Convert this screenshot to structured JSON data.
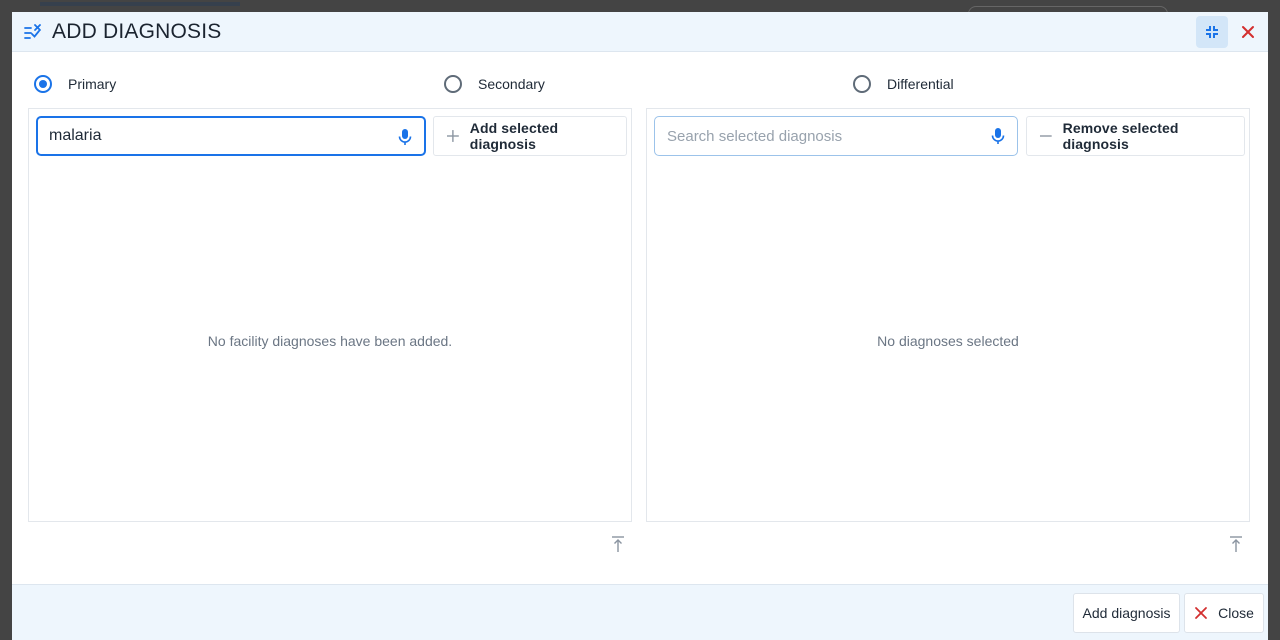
{
  "dialog": {
    "title": "ADD DIAGNOSIS",
    "icons": {
      "title": "playlist-remove-icon",
      "collapse": "fullscreen-exit-icon",
      "close": "close-icon"
    }
  },
  "diagnosis_type": {
    "options": [
      {
        "label": "Primary",
        "selected": true
      },
      {
        "label": "Secondary",
        "selected": false
      },
      {
        "label": "Differential",
        "selected": false
      }
    ]
  },
  "left_panel": {
    "search_value": "malaria",
    "add_button_label": "Add selected diagnosis",
    "empty_message": "No facility diagnoses have been added."
  },
  "right_panel": {
    "search_placeholder": "Search selected diagnosis",
    "remove_button_label": "Remove selected diagnosis",
    "empty_message": "No diagnoses selected"
  },
  "footer": {
    "add_label": "Add diagnosis",
    "close_label": "Close"
  },
  "colors": {
    "accent": "#1a73e8",
    "close_red": "#d32f2f",
    "header_bg": "#eef6fd"
  }
}
